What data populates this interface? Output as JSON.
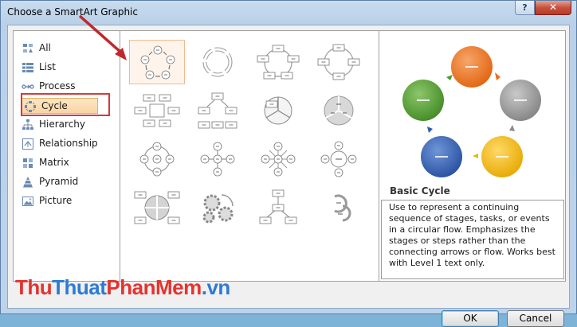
{
  "window": {
    "title": "Choose a SmartArt Graphic",
    "help_label": "?",
    "close_label": "✕"
  },
  "categories": [
    {
      "label": "All",
      "icon": "all-icon"
    },
    {
      "label": "List",
      "icon": "list-icon"
    },
    {
      "label": "Process",
      "icon": "process-icon"
    },
    {
      "label": "Cycle",
      "icon": "cycle-icon",
      "selected": true
    },
    {
      "label": "Hierarchy",
      "icon": "hierarchy-icon"
    },
    {
      "label": "Relationship",
      "icon": "relationship-icon"
    },
    {
      "label": "Matrix",
      "icon": "matrix-icon"
    },
    {
      "label": "Pyramid",
      "icon": "pyramid-icon"
    },
    {
      "label": "Picture",
      "icon": "picture-icon"
    }
  ],
  "gallery": {
    "items": [
      "basic-cycle",
      "text-cycle",
      "block-cycle",
      "continuous-cycle",
      "cycle-matrix",
      "segmented-cycle",
      "nondirectional-cycle",
      "pie-chart-cycle",
      "radial-cycle",
      "diverging-radial",
      "radial-venn",
      "basic-radial",
      "cycle-target",
      "gear",
      "hexagon-radial",
      "circle-arrow"
    ],
    "selected": 0
  },
  "preview": {
    "title": "Basic Cycle",
    "description": "Use to represent a continuing sequence of stages, tasks, or events in a circular flow. Emphasizes the stages or steps rather than the connecting arrows or flow. Works best with Level 1 text only.",
    "colors": [
      "#ef6c1f",
      "#8c8c8c",
      "#f0b400",
      "#2d5bab",
      "#4e9a2f"
    ]
  },
  "buttons": {
    "ok": "OK",
    "cancel": "Cancel"
  },
  "watermark": {
    "part1": "Thu",
    "part2": "Thuat",
    "part3": "PhanMem",
    "part4": ".vn"
  },
  "annotation": {
    "color": "#d23b3b"
  }
}
